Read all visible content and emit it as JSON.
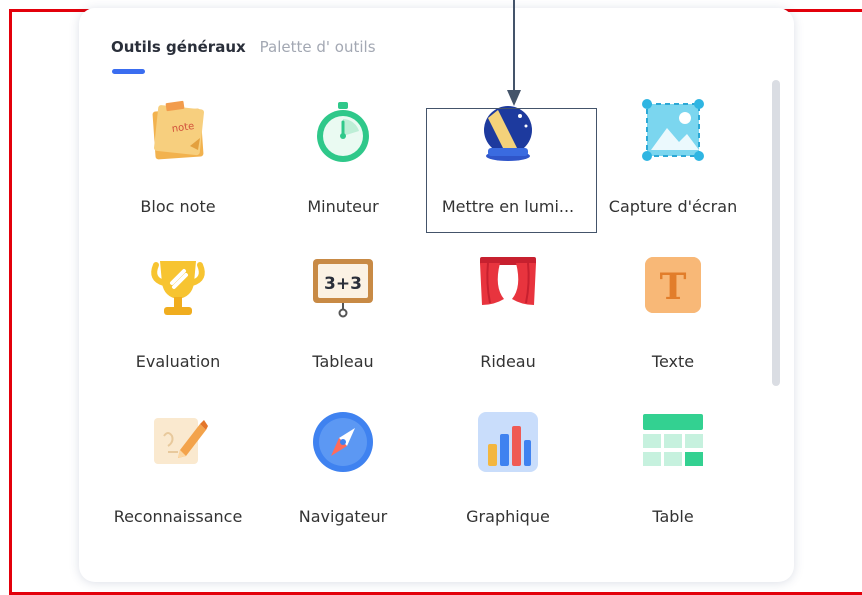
{
  "tabs": [
    {
      "label": "Outils généraux",
      "active": true
    },
    {
      "label": "Palette d'  outils",
      "active": false
    }
  ],
  "accent_color": "#3a6df0",
  "frame_color": "#e3000b",
  "tools": [
    {
      "label": "Bloc note",
      "icon": "sticky-note-icon",
      "highlighted": false
    },
    {
      "label": "Minuteur",
      "icon": "stopwatch-icon",
      "highlighted": false
    },
    {
      "label": "Mettre en lumi...",
      "icon": "spotlight-icon",
      "highlighted": true
    },
    {
      "label": "Capture d'écran",
      "icon": "screenshot-icon",
      "highlighted": false
    },
    {
      "label": "Evaluation",
      "icon": "trophy-icon",
      "highlighted": false
    },
    {
      "label": "Tableau",
      "icon": "blackboard-icon",
      "highlighted": false
    },
    {
      "label": "Rideau",
      "icon": "curtain-icon",
      "highlighted": false
    },
    {
      "label": "Texte",
      "icon": "text-icon",
      "highlighted": false
    },
    {
      "label": "Reconnaissance",
      "icon": "recognition-icon",
      "highlighted": false
    },
    {
      "label": "Navigateur",
      "icon": "compass-icon",
      "highlighted": false
    },
    {
      "label": "Graphique",
      "icon": "bar-chart-icon",
      "highlighted": false
    },
    {
      "label": "Table",
      "icon": "table-icon",
      "highlighted": false
    }
  ],
  "icon_text": {
    "note": "note",
    "board": "3+3",
    "text_letter": "T"
  }
}
